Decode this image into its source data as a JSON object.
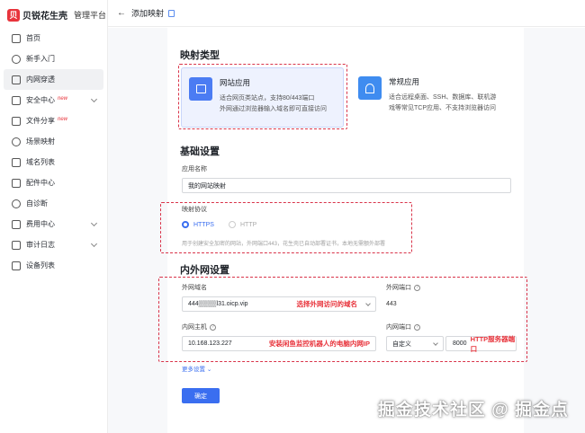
{
  "brand": {
    "logo": "贝",
    "name": "贝锐花生壳",
    "subtitle": "管理平台"
  },
  "sidebar": {
    "items": [
      {
        "label": "首页",
        "icon": "home-icon"
      },
      {
        "label": "新手入门",
        "icon": "rocket-icon"
      },
      {
        "label": "内网穿透",
        "icon": "tunnel-icon",
        "active": true
      },
      {
        "label": "安全中心",
        "icon": "shield-icon",
        "tag": "new"
      },
      {
        "label": "文件分享",
        "icon": "folder-icon",
        "tag": "new"
      },
      {
        "label": "场景映射",
        "icon": "scene-icon"
      },
      {
        "label": "域名列表",
        "icon": "domain-icon"
      },
      {
        "label": "配件中心",
        "icon": "accessory-icon"
      },
      {
        "label": "自诊断",
        "icon": "diagnose-icon"
      },
      {
        "label": "费用中心",
        "icon": "wallet-icon",
        "expandable": true
      },
      {
        "label": "审计日志",
        "icon": "log-icon",
        "expandable": true
      },
      {
        "label": "设备列表",
        "icon": "device-icon"
      }
    ]
  },
  "header": {
    "back": "←",
    "title": "添加映射"
  },
  "mapping_type": {
    "title": "映射类型",
    "web": {
      "name": "网站应用",
      "desc1": "适合网页类站点，支持80/443端口",
      "desc2": "外网通过浏览器输入域名即可直接访问"
    },
    "general": {
      "name": "常规应用",
      "desc1": "适合远程桌面、SSH、数据库、联机游",
      "desc2": "戏等常见TCP应用、不支持浏览器访问"
    }
  },
  "basic": {
    "title": "基础设置",
    "app_name_label": "应用名称",
    "app_name_value": "我的网站映射",
    "protocol_label": "映射协议",
    "protocol_https": "HTTPS",
    "protocol_http": "HTTP",
    "protocol_hint": "用于创建安全加密的网站，外网端口443，花生壳已自动部署证书，本地无需额外部署"
  },
  "network": {
    "title": "内外网设置",
    "ext_domain_label": "外网域名",
    "ext_domain_value": "444▒▒▒▒l31.oicp.vip",
    "ext_domain_note": "选择外网访问的域名",
    "ext_port_label": "外网端口",
    "ext_port_value": "443",
    "int_host_label": "内网主机",
    "int_host_value": "10.168.123.227",
    "int_host_note": "安装闲鱼监控机器人的电脑内网IP",
    "int_port_label": "内网端口",
    "int_port_mode": "自定义",
    "int_port_value": "8000",
    "int_port_note": "HTTP服务器端口"
  },
  "more_settings": "更多设置",
  "confirm": "确定",
  "watermark": "掘金技术社区 @ 掘金点",
  "colors": {
    "accent": "#3a6ef0",
    "annotation": "#d9344a",
    "brand": "#e8343c"
  }
}
